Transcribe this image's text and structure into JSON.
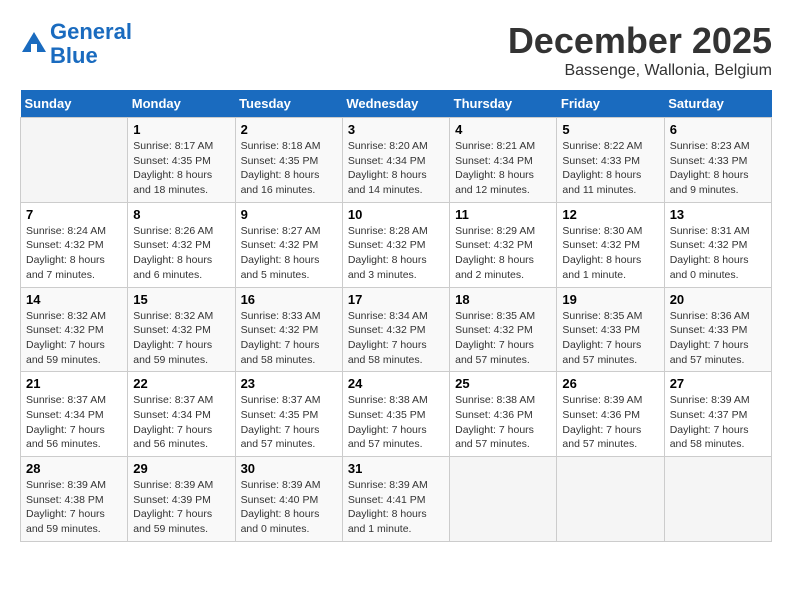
{
  "header": {
    "logo_line1": "General",
    "logo_line2": "Blue",
    "month": "December 2025",
    "location": "Bassenge, Wallonia, Belgium"
  },
  "days_of_week": [
    "Sunday",
    "Monday",
    "Tuesday",
    "Wednesday",
    "Thursday",
    "Friday",
    "Saturday"
  ],
  "weeks": [
    [
      {
        "day": "",
        "content": ""
      },
      {
        "day": "1",
        "content": "Sunrise: 8:17 AM\nSunset: 4:35 PM\nDaylight: 8 hours\nand 18 minutes."
      },
      {
        "day": "2",
        "content": "Sunrise: 8:18 AM\nSunset: 4:35 PM\nDaylight: 8 hours\nand 16 minutes."
      },
      {
        "day": "3",
        "content": "Sunrise: 8:20 AM\nSunset: 4:34 PM\nDaylight: 8 hours\nand 14 minutes."
      },
      {
        "day": "4",
        "content": "Sunrise: 8:21 AM\nSunset: 4:34 PM\nDaylight: 8 hours\nand 12 minutes."
      },
      {
        "day": "5",
        "content": "Sunrise: 8:22 AM\nSunset: 4:33 PM\nDaylight: 8 hours\nand 11 minutes."
      },
      {
        "day": "6",
        "content": "Sunrise: 8:23 AM\nSunset: 4:33 PM\nDaylight: 8 hours\nand 9 minutes."
      }
    ],
    [
      {
        "day": "7",
        "content": "Sunrise: 8:24 AM\nSunset: 4:32 PM\nDaylight: 8 hours\nand 7 minutes."
      },
      {
        "day": "8",
        "content": "Sunrise: 8:26 AM\nSunset: 4:32 PM\nDaylight: 8 hours\nand 6 minutes."
      },
      {
        "day": "9",
        "content": "Sunrise: 8:27 AM\nSunset: 4:32 PM\nDaylight: 8 hours\nand 5 minutes."
      },
      {
        "day": "10",
        "content": "Sunrise: 8:28 AM\nSunset: 4:32 PM\nDaylight: 8 hours\nand 3 minutes."
      },
      {
        "day": "11",
        "content": "Sunrise: 8:29 AM\nSunset: 4:32 PM\nDaylight: 8 hours\nand 2 minutes."
      },
      {
        "day": "12",
        "content": "Sunrise: 8:30 AM\nSunset: 4:32 PM\nDaylight: 8 hours\nand 1 minute."
      },
      {
        "day": "13",
        "content": "Sunrise: 8:31 AM\nSunset: 4:32 PM\nDaylight: 8 hours\nand 0 minutes."
      }
    ],
    [
      {
        "day": "14",
        "content": "Sunrise: 8:32 AM\nSunset: 4:32 PM\nDaylight: 7 hours\nand 59 minutes."
      },
      {
        "day": "15",
        "content": "Sunrise: 8:32 AM\nSunset: 4:32 PM\nDaylight: 7 hours\nand 59 minutes."
      },
      {
        "day": "16",
        "content": "Sunrise: 8:33 AM\nSunset: 4:32 PM\nDaylight: 7 hours\nand 58 minutes."
      },
      {
        "day": "17",
        "content": "Sunrise: 8:34 AM\nSunset: 4:32 PM\nDaylight: 7 hours\nand 58 minutes."
      },
      {
        "day": "18",
        "content": "Sunrise: 8:35 AM\nSunset: 4:32 PM\nDaylight: 7 hours\nand 57 minutes."
      },
      {
        "day": "19",
        "content": "Sunrise: 8:35 AM\nSunset: 4:33 PM\nDaylight: 7 hours\nand 57 minutes."
      },
      {
        "day": "20",
        "content": "Sunrise: 8:36 AM\nSunset: 4:33 PM\nDaylight: 7 hours\nand 57 minutes."
      }
    ],
    [
      {
        "day": "21",
        "content": "Sunrise: 8:37 AM\nSunset: 4:34 PM\nDaylight: 7 hours\nand 56 minutes."
      },
      {
        "day": "22",
        "content": "Sunrise: 8:37 AM\nSunset: 4:34 PM\nDaylight: 7 hours\nand 56 minutes."
      },
      {
        "day": "23",
        "content": "Sunrise: 8:37 AM\nSunset: 4:35 PM\nDaylight: 7 hours\nand 57 minutes."
      },
      {
        "day": "24",
        "content": "Sunrise: 8:38 AM\nSunset: 4:35 PM\nDaylight: 7 hours\nand 57 minutes."
      },
      {
        "day": "25",
        "content": "Sunrise: 8:38 AM\nSunset: 4:36 PM\nDaylight: 7 hours\nand 57 minutes."
      },
      {
        "day": "26",
        "content": "Sunrise: 8:39 AM\nSunset: 4:36 PM\nDaylight: 7 hours\nand 57 minutes."
      },
      {
        "day": "27",
        "content": "Sunrise: 8:39 AM\nSunset: 4:37 PM\nDaylight: 7 hours\nand 58 minutes."
      }
    ],
    [
      {
        "day": "28",
        "content": "Sunrise: 8:39 AM\nSunset: 4:38 PM\nDaylight: 7 hours\nand 59 minutes."
      },
      {
        "day": "29",
        "content": "Sunrise: 8:39 AM\nSunset: 4:39 PM\nDaylight: 7 hours\nand 59 minutes."
      },
      {
        "day": "30",
        "content": "Sunrise: 8:39 AM\nSunset: 4:40 PM\nDaylight: 8 hours\nand 0 minutes."
      },
      {
        "day": "31",
        "content": "Sunrise: 8:39 AM\nSunset: 4:41 PM\nDaylight: 8 hours\nand 1 minute."
      },
      {
        "day": "",
        "content": ""
      },
      {
        "day": "",
        "content": ""
      },
      {
        "day": "",
        "content": ""
      }
    ]
  ]
}
